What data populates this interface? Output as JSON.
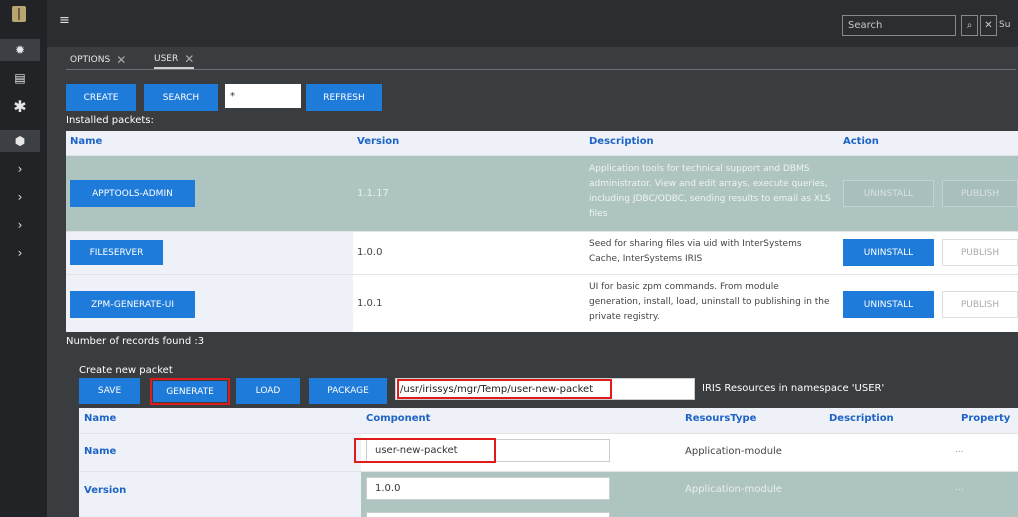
{
  "topbar": {
    "search_placeholder": "Search",
    "search_icon": "search-icon",
    "clear_icon": "close-icon",
    "user_label": "Su"
  },
  "tabs": [
    {
      "label": "OPTIONS"
    },
    {
      "label": "USER"
    }
  ],
  "toolbar": {
    "create": "CREATE",
    "search": "SEARCH",
    "mask": "*",
    "refresh": "REFRESH"
  },
  "installed": {
    "title": "Installed packets:",
    "columns": [
      "Name",
      "Version",
      "Description",
      "Action"
    ],
    "rows": [
      {
        "name": "APPTOOLS-ADMIN",
        "version": "1.1.17",
        "description": "Application tools for technical support and DBMS administrator. View and edit arrays, execute queries, including JDBC/ODBC, sending results to email as XLS files",
        "uninstall": "UNINSTALL",
        "publish": "PUBLISH"
      },
      {
        "name": "FILESERVER",
        "version": "1.0.0",
        "description": "Seed for sharing files via uid with InterSystems Cache, InterSystems IRIS",
        "uninstall": "UNINSTALL",
        "publish": "PUBLISH"
      },
      {
        "name": "ZPM-GENERATE-UI",
        "version": "1.0.1",
        "description": "UI for basic zpm commands. From module generation, install, load, uninstall to publishing in the private registry.",
        "uninstall": "UNINSTALL",
        "publish": "PUBLISH"
      }
    ],
    "count_text": "Number of records found :3"
  },
  "create": {
    "title": "Create new packet",
    "save": "SAVE",
    "generate": "GENERATE",
    "load": "LOAD",
    "package": "PACKAGE",
    "path": "/usr/irissys/mgr/Temp/user-new-packet",
    "namespace_text": "IRIS Resources in namespace 'USER'",
    "columns": [
      "Name",
      "Component",
      "ResoursType",
      "Description",
      "Property"
    ],
    "rows": [
      {
        "name": "Name",
        "component": "user-new-packet",
        "type": "Application-module",
        "property": "..."
      },
      {
        "name": "Version",
        "component": "1.0.0",
        "type": "Application-module",
        "property": "..."
      }
    ]
  },
  "colors": {
    "accent": "#1e7bd9",
    "header_text": "#1d64c6",
    "highlight": "#e01b1b"
  }
}
